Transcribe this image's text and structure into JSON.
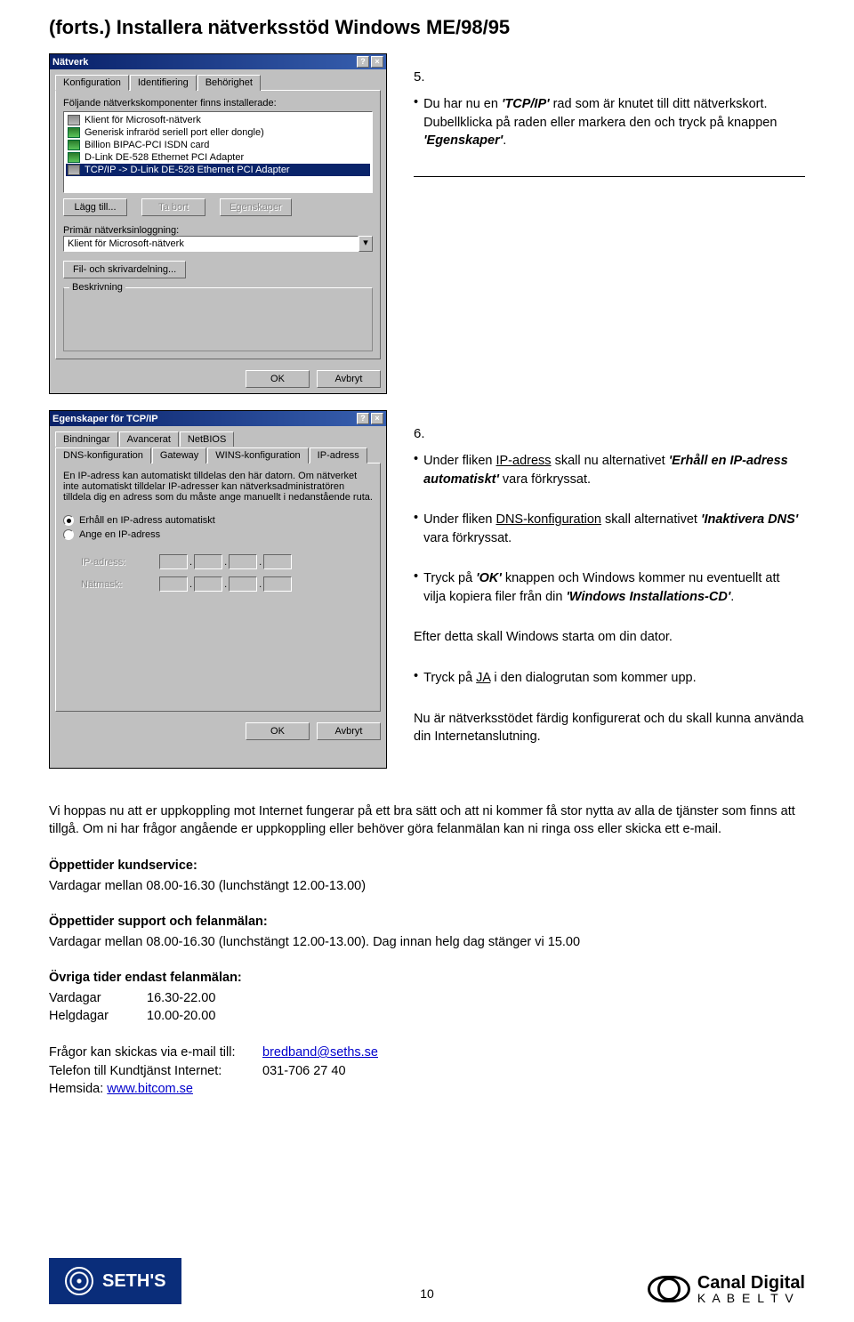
{
  "title": "(forts.) Installera nätverksstöd Windows ME/98/95",
  "dialog1": {
    "title": "Nätverk",
    "tabs": [
      "Konfiguration",
      "Identifiering",
      "Behörighet"
    ],
    "components_label": "Följande nätverkskomponenter finns installerade:",
    "items": [
      "Klient för Microsoft-nätverk",
      "Generisk infraröd seriell port eller dongle)",
      "Billion BIPAC-PCI ISDN card",
      "D-Link DE-528 Ethernet PCI Adapter",
      "TCP/IP -> D-Link DE-528 Ethernet PCI Adapter"
    ],
    "btn_add": "Lägg till...",
    "btn_remove": "Ta bort",
    "btn_props": "Egenskaper",
    "primary_label": "Primär nätverksinloggning:",
    "primary_value": "Klient för Microsoft-nätverk",
    "btn_share": "Fil- och skrivardelning...",
    "desc_label": "Beskrivning",
    "btn_ok": "OK",
    "btn_cancel": "Avbryt"
  },
  "step5": {
    "num": "5.",
    "p1_a": "Du har nu en ",
    "p1_i1": "'TCP/IP'",
    "p1_b": " rad som är knutet till ditt nätverkskort. Dubellklicka på raden eller markera den och tryck på knappen ",
    "p1_i2": "'Egenskaper'",
    "p1_c": "."
  },
  "dialog2": {
    "title": "Egenskaper för TCP/IP",
    "tabs_r1": [
      "Bindningar",
      "Avancerat",
      "NetBIOS"
    ],
    "tabs_r2": [
      "DNS-konfiguration",
      "Gateway",
      "WINS-konfiguration",
      "IP-adress"
    ],
    "desc": "En IP-adress kan automatiskt tilldelas den här datorn. Om nätverket inte automatiskt tilldelar IP-adresser kan nätverksadministratören tilldela dig en adress som du måste ange manuellt i nedanstående ruta.",
    "opt_auto": "Erhåll en IP-adress automatiskt",
    "opt_manual": "Ange en IP-adress",
    "ip_label": "IP-adress:",
    "mask_label": "Nätmask:",
    "btn_ok": "OK",
    "btn_cancel": "Avbryt"
  },
  "step6": {
    "num": "6.",
    "b1_a": "Under fliken ",
    "b1_u": "IP-adress",
    "b1_b": " skall nu alternativet ",
    "b1_i": "'Erhåll en IP-adress automatiskt'",
    "b1_c": " vara förkryssat.",
    "b2_a": "Under fliken ",
    "b2_u": "DNS-konfiguration",
    "b2_b": " skall alternativet ",
    "b2_i": "'Inaktivera DNS'",
    "b2_c": " vara förkryssat.",
    "b3_a": "Tryck på ",
    "b3_i": "'OK'",
    "b3_b": " knappen och Windows kommer nu eventuellt att vilja kopiera filer från din ",
    "b3_i2": "'Windows Installations-CD'",
    "b3_c": ".",
    "b4": "Efter detta skall Windows starta om din dator.",
    "b5_a": "Tryck på ",
    "b5_u": "JA",
    "b5_b": " i den dialogrutan som kommer upp.",
    "b6": "Nu är nätverksstödet färdig konfigurerat och du skall kunna använda din Internetanslutning."
  },
  "body": {
    "intro": "Vi hoppas nu att er uppkoppling mot Internet fungerar på ett bra sätt och att ni kommer få stor nytta av alla de tjänster som finns att tillgå. Om ni har frågor angående er uppkoppling eller behöver göra felanmälan kan ni ringa oss eller skicka ett e-mail.",
    "h1": "Öppettider kundservice:",
    "l1": "Vardagar mellan 08.00-16.30 (lunchstängt 12.00-13.00)",
    "h2": "Öppettider support och felanmälan:",
    "l2": "Vardagar mellan 08.00-16.30 (lunchstängt 12.00-13.00). Dag innan helg dag stänger vi 15.00",
    "h3": "Övriga tider endast felanmälan:",
    "r1a": "Vardagar",
    "r1b": "16.30-22.00",
    "r2a": "Helgdagar",
    "r2b": "10.00-20.00",
    "email_label": "Frågor kan skickas via e-mail till:",
    "email": "bredband@seths.se",
    "phone_label": "Telefon till Kundtjänst Internet:",
    "phone": "031-706 27 40",
    "site_label": "Hemsida:",
    "site": "www.bitcom.se"
  },
  "footer": {
    "seths": "SETH'S",
    "canal": "Canal Digital",
    "kabel": "K A B E L   T V",
    "page": "10"
  }
}
